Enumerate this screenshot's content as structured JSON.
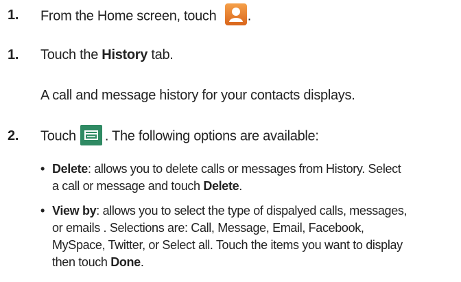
{
  "steps": [
    {
      "num": "1.",
      "text": "From the Home screen, touch",
      "after": "."
    },
    {
      "num": "1.",
      "pre": "Touch the ",
      "bold": "History",
      "post": " tab."
    },
    {
      "num": "2.",
      "pre": "Touch",
      "post": ". The following options are available:"
    }
  ],
  "history_desc": "A call and message history for your contacts displays.",
  "bullets": [
    {
      "term": "Delete",
      "line1": ": allows you to delete calls or messages from History. Select",
      "line2_pre": "a call or message and touch ",
      "line2_bold": "Delete",
      "line2_post": "."
    },
    {
      "term": "View by",
      "line1": ": allows you to select the type of dispalyed calls, messages,",
      "line2": "or emails . Selections are: Call, Message, Email, Facebook,",
      "line3": "MySpace, Twitter, or Select all. Touch the items you want to display",
      "line4_pre": "then touch ",
      "line4_bold": "Done",
      "line4_post": "."
    }
  ],
  "icons": {
    "contacts": "contacts-app-icon",
    "menu": "menu-key-icon"
  },
  "colors": {
    "contacts_icon_bg": "#e8822a",
    "menu_icon_bg": "#2f8a63"
  }
}
